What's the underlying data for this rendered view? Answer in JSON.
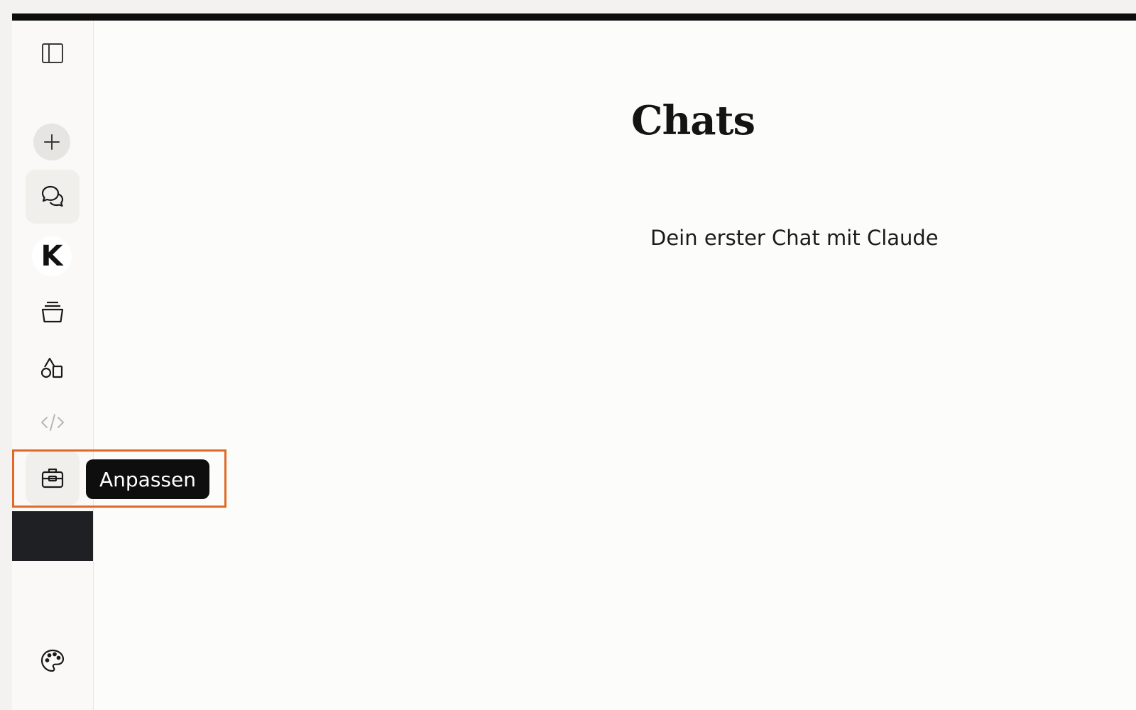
{
  "sidebar": {
    "items": [
      {
        "name": "toggle-sidebar",
        "icon": "sidebar-panel-icon"
      },
      {
        "name": "new-chat",
        "icon": "plus-icon"
      },
      {
        "name": "chats",
        "icon": "chat-bubbles-icon"
      },
      {
        "name": "profile",
        "icon": "avatar-k-icon",
        "label": "K"
      },
      {
        "name": "projects",
        "icon": "stack-icon"
      },
      {
        "name": "artifacts",
        "icon": "shapes-icon"
      },
      {
        "name": "code",
        "icon": "code-icon"
      },
      {
        "name": "customize",
        "icon": "briefcase-icon"
      },
      {
        "name": "appearance",
        "icon": "palette-icon"
      }
    ],
    "tooltip": "Anpassen"
  },
  "main": {
    "title": "Chats",
    "chats": [
      {
        "title": "Dein erster Chat mit Claude"
      }
    ]
  },
  "colors": {
    "highlight": "#e06a25",
    "tooltip_bg": "#0e0e0e",
    "background": "#fcfcfb"
  }
}
